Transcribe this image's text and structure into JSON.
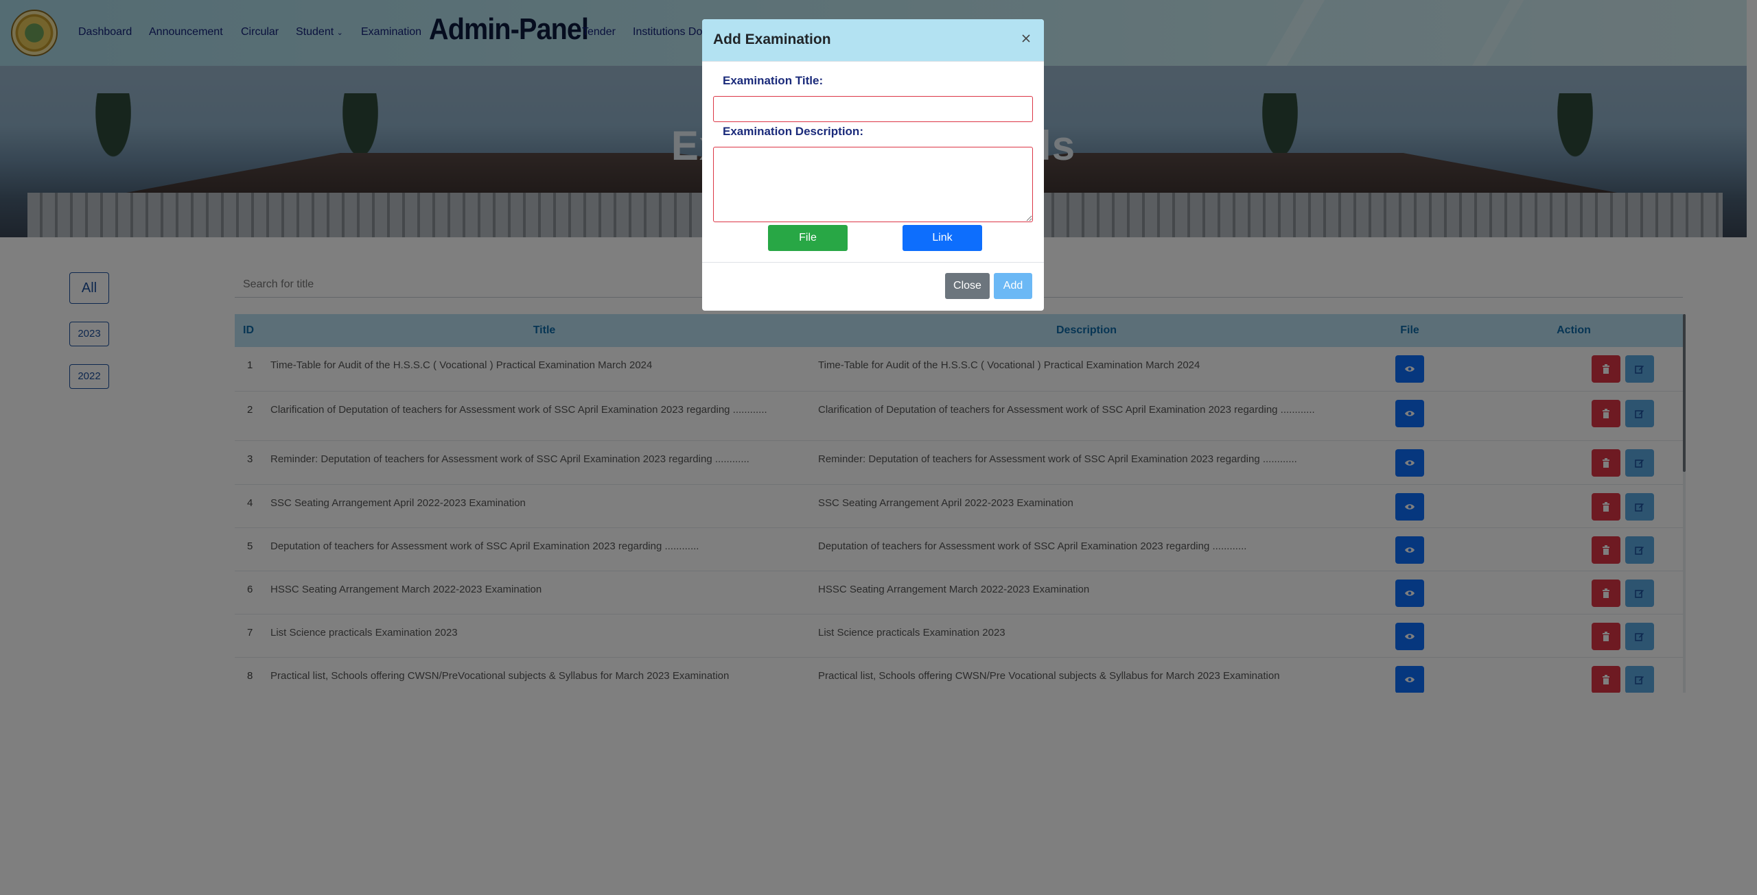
{
  "header": {
    "brand": "Admin-Panel",
    "nav": [
      {
        "label": "Dashboard"
      },
      {
        "label": "Announcement"
      },
      {
        "label": "Circular"
      },
      {
        "label": "Student"
      },
      {
        "label": "Examination"
      },
      {
        "label": "Tender"
      },
      {
        "label": "Institutions Do"
      }
    ]
  },
  "hero": {
    "title": "Examination Details"
  },
  "filters": [
    "All",
    "2023",
    "2022"
  ],
  "search": {
    "placeholder": "Search for title"
  },
  "table": {
    "headers": {
      "id": "ID",
      "title": "Title",
      "description": "Description",
      "file": "File",
      "action": "Action"
    },
    "rows": [
      {
        "id": "1",
        "title": "Time-Table for Audit of the H.S.S.C ( Vocational ) Practical Examination March 2024",
        "description": "Time-Table for Audit of the H.S.S.C ( Vocational ) Practical Examination March 2024"
      },
      {
        "id": "2",
        "title": "Clarification of Deputation of teachers for Assessment work of SSC April Examination 2023 regarding ............",
        "description": "Clarification of Deputation of teachers for Assessment work of SSC April Examination 2023 regarding ............"
      },
      {
        "id": "3",
        "title": "Reminder: Deputation of teachers for Assessment work of SSC April Examination 2023 regarding ............",
        "description": "Reminder: Deputation of teachers for Assessment work of SSC April Examination 2023 regarding ............"
      },
      {
        "id": "4",
        "title": "SSC Seating Arrangement April 2022-2023 Examination",
        "description": "SSC Seating Arrangement April 2022-2023 Examination"
      },
      {
        "id": "5",
        "title": "Deputation of teachers for Assessment work of SSC April Examination 2023 regarding ............",
        "description": "Deputation of teachers for Assessment work of SSC April Examination 2023 regarding ............"
      },
      {
        "id": "6",
        "title": "HSSC Seating Arrangement March 2022-2023 Examination",
        "description": "HSSC Seating Arrangement March 2022-2023 Examination"
      },
      {
        "id": "7",
        "title": "List Science practicals Examination 2023",
        "description": "List Science practicals Examination 2023"
      },
      {
        "id": "8",
        "title": "Practical list, Schools offering CWSN/PreVocational subjects & Syllabus for March 2023 Examination",
        "description": "Practical list, Schools offering CWSN/Pre Vocational subjects & Syllabus for March 2023 Examination"
      }
    ]
  },
  "modal": {
    "title": "Add Examination",
    "title_label": "Examination Title:",
    "title_value": "",
    "description_label": "Examination Description:",
    "description_value": "",
    "file_button": "File",
    "link_button": "Link",
    "close_button": "Close",
    "add_button": "Add"
  },
  "colors": {
    "accent_blue": "#0d6efd",
    "danger": "#dc3545",
    "success": "#28a745",
    "modal_header": "#b3e2f2"
  }
}
